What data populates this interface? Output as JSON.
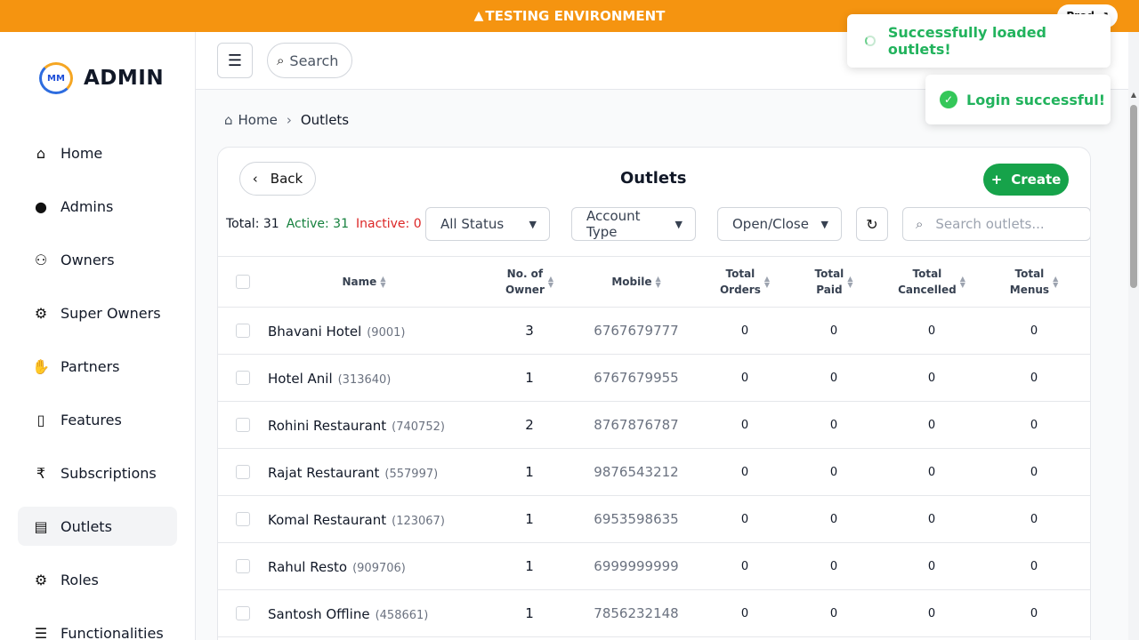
{
  "banner": {
    "text": "TESTING ENVIRONMENT",
    "prod_label": "Prod"
  },
  "sidebar": {
    "logo_text": "ADMIN",
    "logo_mark": "MM",
    "items": [
      {
        "label": "Home",
        "icon": "home-icon"
      },
      {
        "label": "Admins",
        "icon": "user-icon"
      },
      {
        "label": "Owners",
        "icon": "users-icon"
      },
      {
        "label": "Super Owners",
        "icon": "user-gear-icon"
      },
      {
        "label": "Partners",
        "icon": "handshake-icon"
      },
      {
        "label": "Features",
        "icon": "mobile-icon"
      },
      {
        "label": "Subscriptions",
        "icon": "rupee-icon"
      },
      {
        "label": "Outlets",
        "icon": "store-icon",
        "active": true
      },
      {
        "label": "Roles",
        "icon": "user-gear-icon"
      },
      {
        "label": "Functionalities",
        "icon": "list-icon"
      }
    ]
  },
  "header": {
    "search_label": "Search"
  },
  "breadcrumb": {
    "home": "Home",
    "current": "Outlets"
  },
  "page": {
    "title": "Outlets",
    "back_label": "Back",
    "create_label": "Create",
    "counts": {
      "total": "Total: 31",
      "active": "Active: 31",
      "inactive": "Inactive: 0"
    },
    "filters": {
      "status": "All Status",
      "account_type": "Account Type",
      "open_close": "Open/Close"
    },
    "search_placeholder": "Search outlets..."
  },
  "table": {
    "headers": {
      "name": "Name",
      "owners_1": "No. of",
      "owners_2": "Owner",
      "mobile": "Mobile",
      "orders_1": "Total",
      "orders_2": "Orders",
      "paid_1": "Total",
      "paid_2": "Paid",
      "cancelled_1": "Total",
      "cancelled_2": "Cancelled",
      "menus_1": "Total",
      "menus_2": "Menus"
    },
    "rows": [
      {
        "name": "Bhavani Hotel",
        "id": "(9001)",
        "owners": "3",
        "mobile": "6767679777",
        "orders": "0",
        "paid": "0",
        "cancelled": "0",
        "menus": "0"
      },
      {
        "name": "Hotel Anil",
        "id": "(313640)",
        "owners": "1",
        "mobile": "6767679955",
        "orders": "0",
        "paid": "0",
        "cancelled": "0",
        "menus": "0"
      },
      {
        "name": "Rohini Restaurant",
        "id": "(740752)",
        "owners": "2",
        "mobile": "8767876787",
        "orders": "0",
        "paid": "0",
        "cancelled": "0",
        "menus": "0"
      },
      {
        "name": "Rajat Restaurant",
        "id": "(557997)",
        "owners": "1",
        "mobile": "9876543212",
        "orders": "0",
        "paid": "0",
        "cancelled": "0",
        "menus": "0"
      },
      {
        "name": "Komal Restaurant",
        "id": "(123067)",
        "owners": "1",
        "mobile": "6953598635",
        "orders": "0",
        "paid": "0",
        "cancelled": "0",
        "menus": "0"
      },
      {
        "name": "Rahul Resto",
        "id": "(909706)",
        "owners": "1",
        "mobile": "6999999999",
        "orders": "0",
        "paid": "0",
        "cancelled": "0",
        "menus": "0"
      },
      {
        "name": "Santosh Offline",
        "id": "(458661)",
        "owners": "1",
        "mobile": "7856232148",
        "orders": "0",
        "paid": "0",
        "cancelled": "0",
        "menus": "0"
      }
    ]
  },
  "toasts": [
    {
      "text": "Successfully loaded outlets!"
    },
    {
      "text": "Login successful!"
    }
  ],
  "colors": {
    "banner": "#f59410",
    "primary": "#16a34a",
    "toast_text": "#22b35d",
    "inactive": "#dc2626"
  }
}
